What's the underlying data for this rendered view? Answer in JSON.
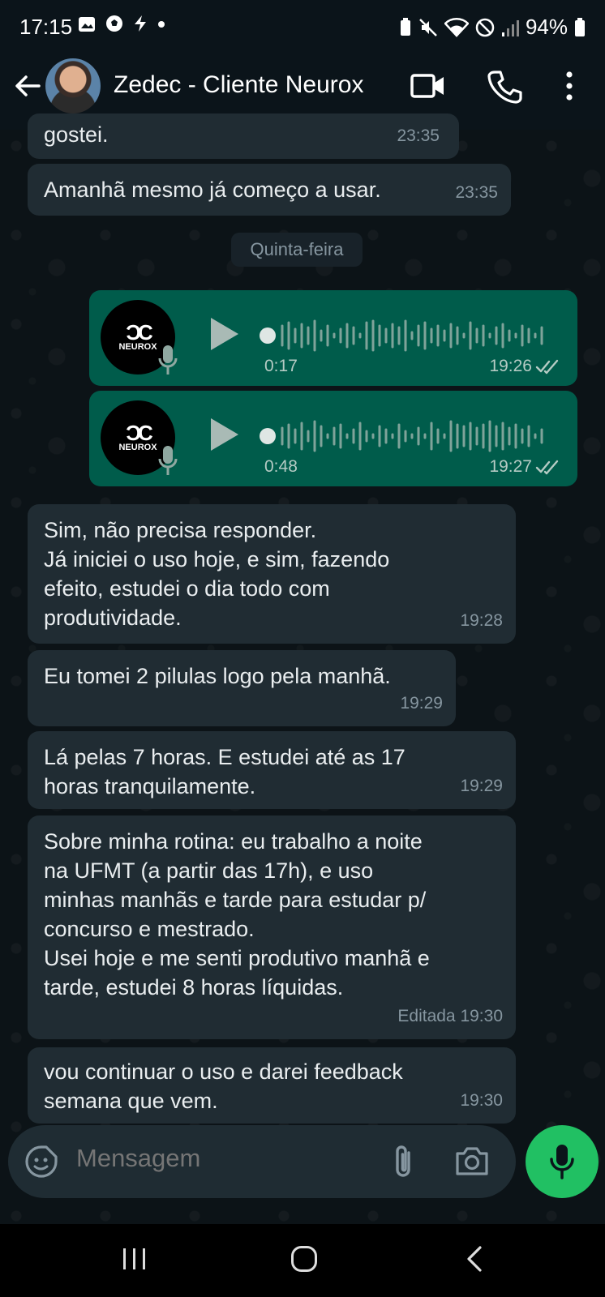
{
  "status_bar": {
    "time": "17:15",
    "left_icons": [
      "gallery-icon",
      "soccer-icon",
      "bolt-icon",
      "dot-icon"
    ],
    "right_icons": [
      "battery-saver-icon",
      "mute-icon",
      "wifi-icon",
      "dnd-icon",
      "signal-icon"
    ],
    "battery": "94%"
  },
  "header": {
    "contact_name": "Zedec - Cliente Neurox"
  },
  "messages": {
    "m0": {
      "text": "gostei.",
      "time": "23:35"
    },
    "m1": {
      "text": "Amanhã mesmo já começo a usar.",
      "time": "23:35"
    },
    "date_chip": "Quinta-feira",
    "audio1": {
      "duration": "0:17",
      "time": "19:26",
      "logo_text": "NEUROX"
    },
    "audio2": {
      "duration": "0:48",
      "time": "19:27",
      "logo_text": "NEUROX"
    },
    "m2": {
      "text": "Sim, não precisa responder.\nJá iniciei o uso hoje, e sim, fazendo\nefeito, estudei o dia todo com\nprodutividade.",
      "time": "19:28"
    },
    "m3": {
      "text": "Eu tomei 2 pilulas logo pela manhã.",
      "time": "19:29"
    },
    "m4": {
      "text": "Lá pelas 7 horas. E estudei até as 17\nhoras tranquilamente.",
      "time": "19:29"
    },
    "m5": {
      "text": "Sobre minha rotina: eu trabalho a noite\nna UFMT (a partir das 17h), e uso\nminhas manhãs e tarde para estudar p/\nconcurso e mestrado.\nUsei hoje e me senti produtivo manhã e\ntarde, estudei 8 horas líquidas.",
      "time": "Editada 19:30"
    },
    "m6": {
      "text": "vou continuar o uso e darei feedback\nsemana que vem.",
      "time": "19:30"
    }
  },
  "input": {
    "placeholder": "Mensagem"
  },
  "colors": {
    "incoming_bubble": "#202c33",
    "outgoing_bubble": "#005c4b",
    "mic_button": "#21c063",
    "background": "#0b141a"
  }
}
